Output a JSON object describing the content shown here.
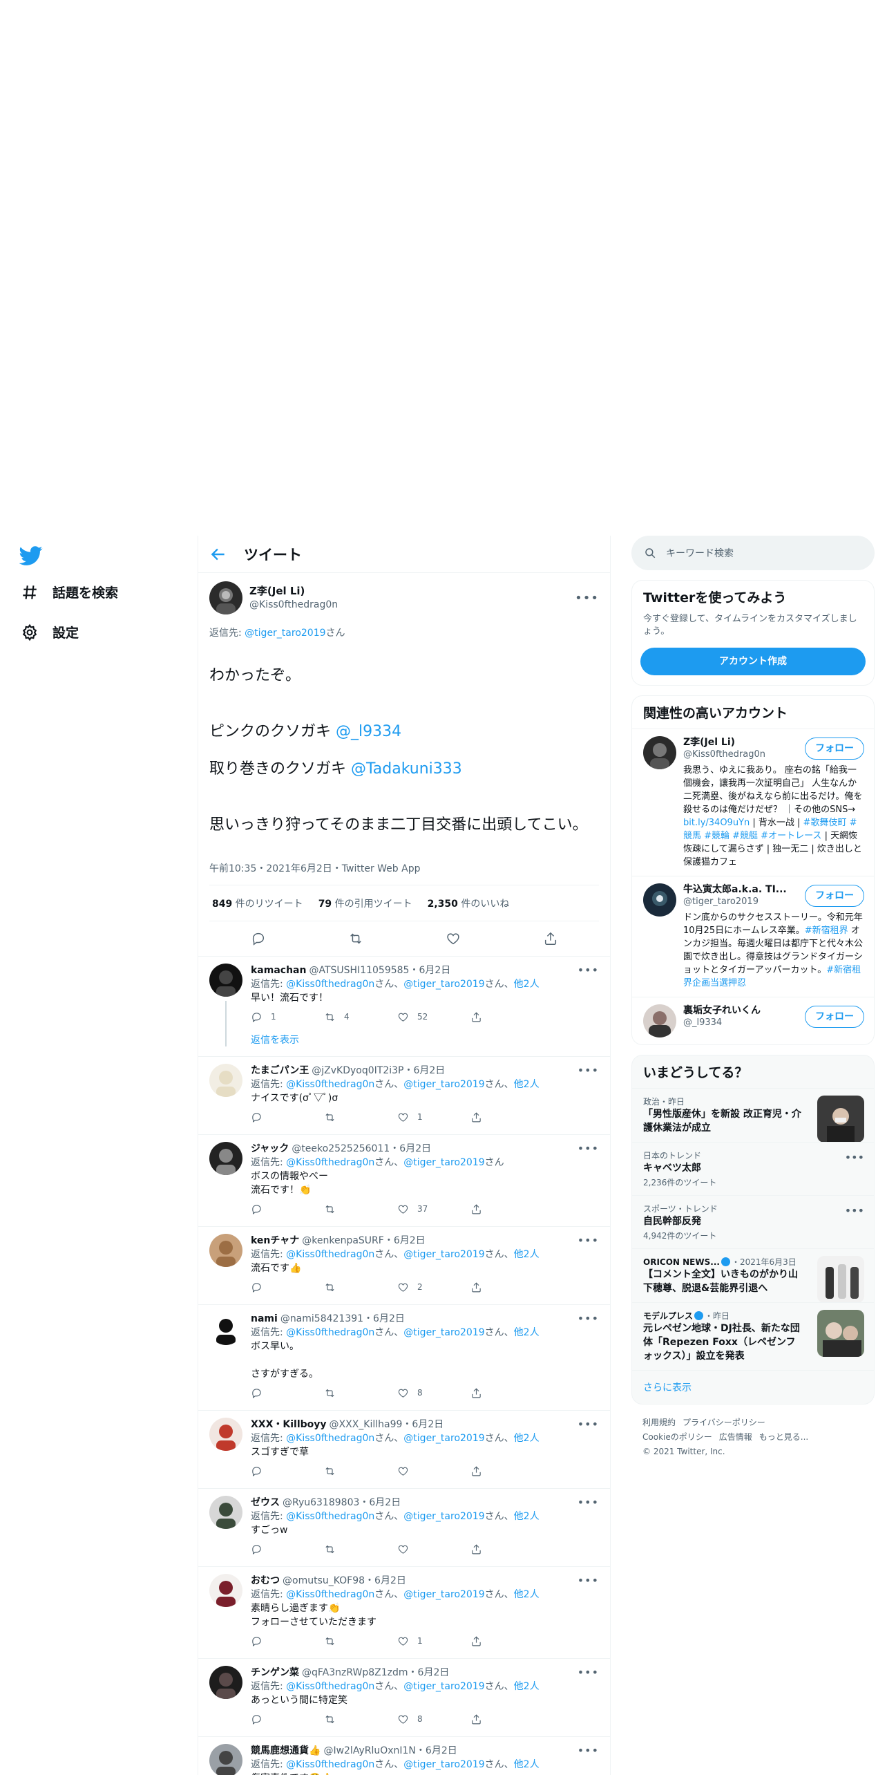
{
  "nav": {
    "explore": "話題を検索",
    "settings": "設定"
  },
  "header": {
    "title": "ツイート"
  },
  "focal": {
    "name": "Z李(Jel Li)",
    "handle": "@Kiss0fthedrag0n",
    "reply_prefix": "返信先: ",
    "reply_to": "@tiger_taro2019",
    "reply_suffix": "さん",
    "text_1": "わかったぞ。",
    "text_2a": "ピンクのクソガキ ",
    "mention_1": "@_l9334",
    "text_2b": "取り巻きのクソガキ ",
    "mention_2": "@Tadakuni333",
    "text_3": "思いっきり狩ってそのまま二丁目交番に出頭してこい。",
    "meta": "午前10:35・2021年6月2日・Twitter Web App",
    "retweets": "849",
    "retweets_label": " 件のリツイート",
    "quotes": "79",
    "quotes_label": " 件の引用ツイート",
    "likes": "2,350",
    "likes_label": " 件のいいね"
  },
  "replies": [
    {
      "name": "kamachan",
      "handle": "@ATSUSHI11059585",
      "date": "・6月2日",
      "reply_a": "@Kiss0fthedrag0n",
      "reply_b": "@tiger_taro2019",
      "others": "他2人",
      "text": "早い！流石です！",
      "replies": "1",
      "retweets": "4",
      "likes": "52",
      "show_replies": "返信を表示"
    },
    {
      "name": "たまごパン王",
      "handle": "@jZvKDyoq0IT2i3P",
      "date": "・6月2日",
      "reply_a": "@Kiss0fthedrag0n",
      "reply_b": "@tiger_taro2019",
      "others": "他2人",
      "text": "ナイスです(σﾟ▽ﾟ)σ",
      "replies": "",
      "retweets": "",
      "likes": "1"
    },
    {
      "name": "ジャック",
      "handle": "@teeko2525256011",
      "date": "・6月2日",
      "reply_a": "@Kiss0fthedrag0n",
      "reply_b": "@tiger_taro2019",
      "others": "",
      "text": "ボスの情報やべー\n流石です！👏",
      "replies": "",
      "retweets": "",
      "likes": "37"
    },
    {
      "name": "kenチャナ",
      "handle": "@kenkenpaSURF",
      "date": "・6月2日",
      "reply_a": "@Kiss0fthedrag0n",
      "reply_b": "@tiger_taro2019",
      "others": "他2人",
      "text": "流石です👍",
      "replies": "",
      "retweets": "",
      "likes": "2"
    },
    {
      "name": "nami",
      "handle": "@nami58421391",
      "date": "・6月2日",
      "reply_a": "@Kiss0fthedrag0n",
      "reply_b": "@tiger_taro2019",
      "others": "他2人",
      "text": "ボス早い。\n\nさすがすぎる。",
      "replies": "",
      "retweets": "",
      "likes": "8"
    },
    {
      "name": "XXX・Killboyy",
      "handle": "@XXX_Killha99",
      "date": "・6月2日",
      "reply_a": "@Kiss0fthedrag0n",
      "reply_b": "@tiger_taro2019",
      "others": "他2人",
      "text": "スゴすぎで草",
      "replies": "",
      "retweets": "",
      "likes": ""
    },
    {
      "name": "ゼウス",
      "handle": "@Ryu63189803",
      "date": "・6月2日",
      "reply_a": "@Kiss0fthedrag0n",
      "reply_b": "@tiger_taro2019",
      "others": "他2人",
      "text": "すごっw",
      "replies": "",
      "retweets": "",
      "likes": ""
    },
    {
      "name": "おむつ",
      "handle": "@omutsu_KOF98",
      "date": "・6月2日",
      "reply_a": "@Kiss0fthedrag0n",
      "reply_b": "@tiger_taro2019",
      "others": "他2人",
      "text": "素晴らし過ぎます👏\nフォローさせていただきます",
      "replies": "",
      "retweets": "",
      "likes": "1"
    },
    {
      "name": "チンゲン菜",
      "handle": "@qFA3nzRWp8Z1zdm",
      "date": "・6月2日",
      "reply_a": "@Kiss0fthedrag0n",
      "reply_b": "@tiger_taro2019",
      "others": "他2人",
      "text": "あっという間に特定笑",
      "replies": "",
      "retweets": "",
      "likes": "8"
    },
    {
      "name": "競馬鹿想通貨👍",
      "handle": "@Iw2lAyRluOxnI1N",
      "date": "・6月2日",
      "reply_a": "@Kiss0fthedrag0n",
      "reply_b": "@tiger_taro2019",
      "others": "他2人",
      "text": "傷害事件です😤👍",
      "replies": "",
      "retweets": "",
      "likes": ""
    }
  ],
  "reply_labels": {
    "prefix": "返信先: ",
    "san": "さん",
    "sep": "、"
  },
  "search": {
    "placeholder": "キーワード検索"
  },
  "signup": {
    "title": "Twitterを使ってみよう",
    "desc": "今すぐ登録して、タイムラインをカスタマイズしましょう。",
    "button": "アカウント作成"
  },
  "related": {
    "title": "関連性の高いアカウント",
    "follow": "フォロー",
    "accounts": [
      {
        "name": "Z李(Jel Li)",
        "handle": "@Kiss0fthedrag0n",
        "bio": "我思う、ゆえに我あり。 座右の銘「給我一個機会，讓我再一次証明自己」 人生なんか二死満塁、後がねえなら前に出るだけ。俺を殺せるのは俺だけだぜ？ ｜その他のSNS→ ",
        "bio_link": "bit.ly/34O9uYn",
        "bio_rest": " | 背水一战 | ",
        "bio_tags": "#歌舞伎町 #競馬 #競輪 #競艇 #オートレース",
        "bio_tail": " | 天網恢恢疎にして漏らさず | 独一无二 | 炊き出しと保護猫カフェ"
      },
      {
        "name": "牛込寅太郎a.k.a. TI...",
        "handle": "@tiger_taro2019",
        "bio": "ドン底からのサクセスストーリー。令和元年10月25日にホームレス卒業。",
        "bio_tags": "#新宿租界",
        "bio_rest": " オンカジ担当。毎週火曜日は都庁下と代々木公園で炊き出し。得意技はグランドタイガーショットとタイガーアッパーカット。",
        "bio_tail": "#新宿租界企画当選押忍"
      },
      {
        "name": "裏垢女子れいくん",
        "handle": "@_l9334",
        "bio": ""
      }
    ]
  },
  "trends": {
    "title": "いまどうしてる？",
    "items": [
      {
        "cat": "政治・昨日",
        "title": "「男性版産休」を新設 改正育児・介護休業法が成立",
        "count": ""
      },
      {
        "cat": "日本のトレンド",
        "title": "キャベツ太郎",
        "count": "2,236件のツイート"
      },
      {
        "cat": "スポーツ・トレンド",
        "title": "自民幹部反発",
        "count": "4,942件のツイート"
      },
      {
        "cat": "ORICON NEWS...",
        "cat_date": "・2021年6月3日",
        "title": "【コメント全文】いきものがかり山下穂尊、脱退&芸能界引退へ",
        "count": ""
      },
      {
        "cat": "モデルプレス",
        "cat_date": "・昨日",
        "title": "元レペゼン地球・DJ社長、新たな団体「Repezen Foxx（レペゼンフォックス）」設立を発表",
        "count": ""
      }
    ],
    "show_more": "さらに表示"
  },
  "footer": {
    "terms": "利用規約",
    "privacy": "プライバシーポリシー",
    "cookie": "Cookieのポリシー",
    "ads": "広告情報",
    "more": "もっと見る...",
    "copyright": "© 2021 Twitter, Inc."
  },
  "colors": {
    "accent": "#1d9bf0",
    "text": "#0f1419",
    "muted": "#536471",
    "border": "#eff3f4"
  }
}
